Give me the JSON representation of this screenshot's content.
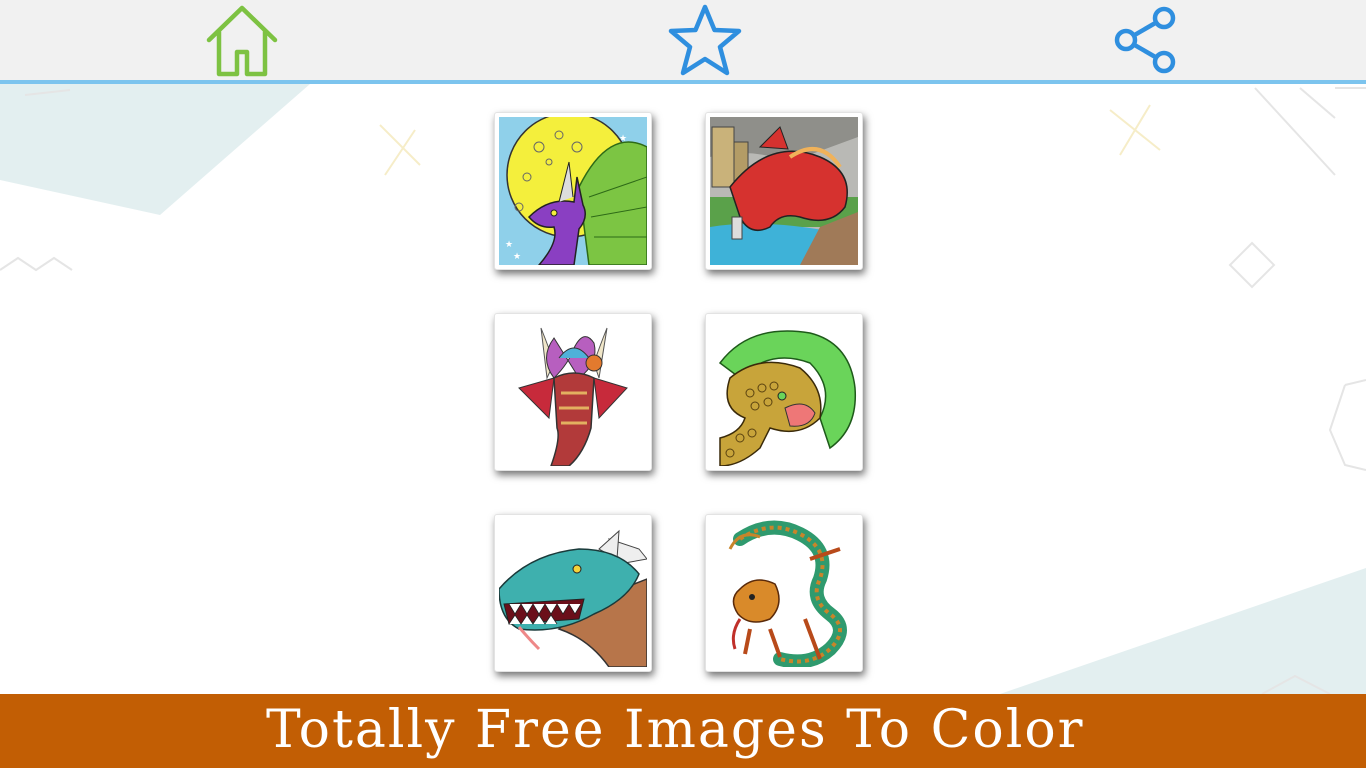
{
  "toolbar": {
    "home_icon": "home-icon",
    "favorites_icon": "star-icon",
    "share_icon": "share-icon",
    "colors": {
      "home": "#7dc242",
      "star": "#2f8fdf",
      "share": "#2f8fdf",
      "underline": "#7cc4ee"
    }
  },
  "gallery": {
    "items": [
      {
        "subject": "dragon-with-moon-image"
      },
      {
        "subject": "red-dragon-castle-image"
      },
      {
        "subject": "fairy-on-dragon-image"
      },
      {
        "subject": "green-serpent-dragon-image"
      },
      {
        "subject": "teal-dragon-head-image"
      },
      {
        "subject": "chinese-dragon-image"
      }
    ]
  },
  "banner": {
    "text": "Totally Free Images To Color",
    "background": "#c25e04",
    "text_color": "#ffffff"
  }
}
